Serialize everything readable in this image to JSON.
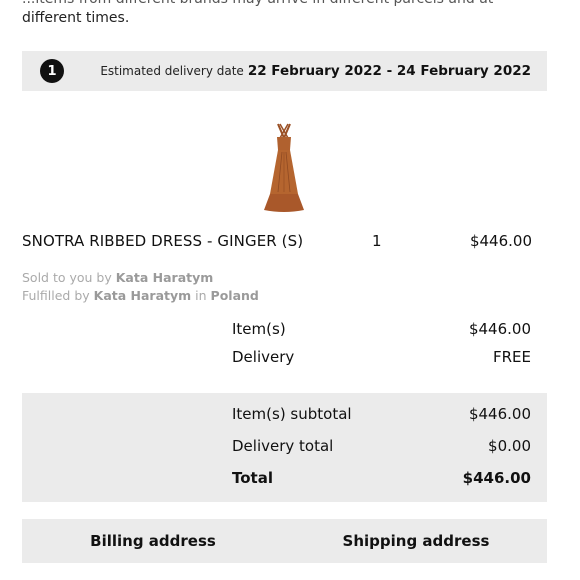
{
  "intro": {
    "line1": "different times.",
    "line0": "...items from different brands may arrive in different parcels and at"
  },
  "shipment": {
    "number": "1",
    "estimate_label": "Estimated delivery date",
    "estimate_dates": "22 February 2022 - 24 February 2022"
  },
  "item": {
    "name": "SNOTRA RIBBED DRESS - GINGER (S)",
    "quantity": "1",
    "price": "$446.00",
    "image_icon": "dress-image",
    "sold_prefix": "Sold to you by",
    "sold_by": "Kata Haratym",
    "fulfilled_prefix": "Fulfilled by",
    "fulfilled_by": "Kata Haratym",
    "fulfilled_in_word": "in",
    "fulfilled_country": "Poland",
    "image_color": "#b0612f"
  },
  "summary": {
    "items_label": "Item(s)",
    "items_value": "$446.00",
    "delivery_label": "Delivery",
    "delivery_value": "FREE"
  },
  "totals": {
    "subtotal_label": "Item(s) subtotal",
    "subtotal_value": "$446.00",
    "delivery_total_label": "Delivery total",
    "delivery_total_value": "$0.00",
    "total_label": "Total",
    "total_value": "$446.00"
  },
  "addresses": {
    "billing_label": "Billing address",
    "shipping_label": "Shipping address"
  }
}
